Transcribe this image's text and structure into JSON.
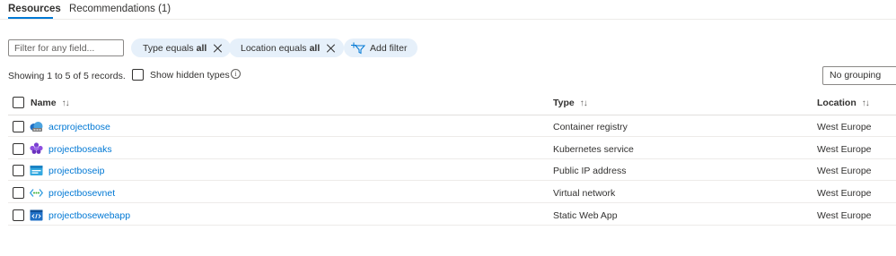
{
  "tabs": [
    {
      "label": "Resources"
    },
    {
      "label": "Recommendations (1)"
    }
  ],
  "filter": {
    "placeholder": "Filter for any field..."
  },
  "pills": [
    {
      "prefix": "Type equals",
      "value": "all"
    },
    {
      "prefix": "Location equals",
      "value": "all"
    }
  ],
  "add_filter": {
    "label": "Add filter",
    "icon": "add-filter-icon"
  },
  "records_text": "Showing 1 to 5 of 5 records.",
  "show_hidden": {
    "label": "Show hidden types",
    "checked": false
  },
  "grouping": {
    "value": "No grouping"
  },
  "columns": {
    "name": "Name",
    "type": "Type",
    "location": "Location",
    "sort_icon": "↑↓"
  },
  "rows": [
    {
      "name": "acrprojectbose",
      "type": "Container registry",
      "location": "West Europe",
      "icon": "container-registry-icon"
    },
    {
      "name": "projectboseaks",
      "type": "Kubernetes service",
      "location": "West Europe",
      "icon": "kubernetes-service-icon"
    },
    {
      "name": "projectboseip",
      "type": "Public IP address",
      "location": "West Europe",
      "icon": "public-ip-icon"
    },
    {
      "name": "projectbosevnet",
      "type": "Virtual network",
      "location": "West Europe",
      "icon": "virtual-network-icon"
    },
    {
      "name": "projectbosewebapp",
      "type": "Static Web App",
      "location": "West Europe",
      "icon": "static-web-app-icon"
    }
  ],
  "colors": {
    "accent": "#0078d4",
    "pill_bg": "#e6f0fa"
  }
}
